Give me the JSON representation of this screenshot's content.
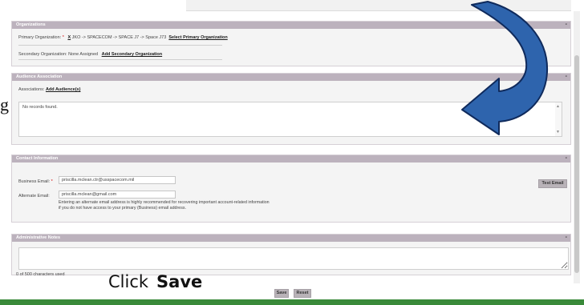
{
  "organizations": {
    "header": "Organizations",
    "primary_label": "Primary Organization:",
    "primary_required": "*",
    "primary_code": "X",
    "primary_path": "JKO -> SPACECOM -> SPACE J7 -> Space J73",
    "select_primary_link": "Select Primary Organization",
    "secondary_text": "Secondary Organization: None Assigned",
    "add_secondary_link": "Add Secondary Organization"
  },
  "audience": {
    "header": "Audience Association",
    "associations_label": "Associations:",
    "add_audiences_link": "Add Audience(s)",
    "empty_text": "No records found."
  },
  "contact": {
    "header": "Contact Information",
    "business_label": "Business Email:",
    "business_required": "*",
    "business_value": "priscilla.mclean.ctr@usspacecom.mil",
    "alternate_label": "Alternate Email:",
    "alternate_value": "priscilla.mclean@gmail.com",
    "help_line1": "Entering an alternate email address is highly recommended for recovering important account-related information",
    "help_line2": "if you do not have access to your primary (Business) email address.",
    "test_email_button": "Test Email"
  },
  "notes": {
    "header": "Administrative Notes",
    "char_count": "0 of 500 characters used"
  },
  "actions": {
    "save_button": "Save",
    "reset_button": "Reset"
  },
  "collapse_symbol": "-",
  "stray_letter": "g",
  "annotation": {
    "click_text": "Click",
    "save_text": "Save"
  },
  "colors": {
    "panel_header": "#bcb2bd",
    "arrow_fill": "#2e64ad",
    "arrow_stroke": "#0f2a5c",
    "footer_green": "#3a8a3a"
  },
  "icons": {
    "arrow": "curved-arrow-icon",
    "collapse": "minus-icon",
    "scroll_up": "triangle-up-icon",
    "scroll_down": "triangle-down-icon"
  }
}
